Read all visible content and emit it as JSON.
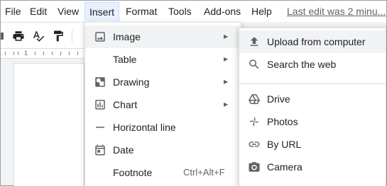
{
  "menubar": {
    "items": [
      "File",
      "Edit",
      "View",
      "Insert",
      "Format",
      "Tools",
      "Add-ons",
      "Help"
    ],
    "last_edit": "Last edit was 2 minu..."
  },
  "toolbar": {
    "icons": [
      "print-icon",
      "spellcheck-icon",
      "paint-format-icon"
    ]
  },
  "ruler": {
    "number": "1"
  },
  "insert_menu": {
    "items": [
      {
        "label": "Image",
        "icon": "image-icon",
        "has_submenu": true
      },
      {
        "label": "Table",
        "icon": "",
        "has_submenu": true
      },
      {
        "label": "Drawing",
        "icon": "drawing-icon",
        "has_submenu": true
      },
      {
        "label": "Chart",
        "icon": "chart-icon",
        "has_submenu": true
      },
      {
        "label": "Horizontal line",
        "icon": "horizontal-line-icon",
        "has_submenu": false
      },
      {
        "label": "Date",
        "icon": "calendar-icon",
        "has_submenu": false
      },
      {
        "label": "Footnote",
        "icon": "",
        "shortcut": "Ctrl+Alt+F",
        "has_submenu": false
      }
    ]
  },
  "image_submenu": {
    "items": [
      {
        "label": "Upload from computer",
        "icon": "upload-icon"
      },
      {
        "label": "Search the web",
        "icon": "search-icon"
      },
      {
        "label": "Drive",
        "icon": "drive-icon"
      },
      {
        "label": "Photos",
        "icon": "photos-icon"
      },
      {
        "label": "By URL",
        "icon": "link-icon"
      },
      {
        "label": "Camera",
        "icon": "camera-icon"
      }
    ]
  },
  "colors": {
    "hover_bg": "#f1f3f4",
    "active_menu_bg": "#e8f0fe",
    "icon": "#5f6368",
    "text": "#202124"
  }
}
